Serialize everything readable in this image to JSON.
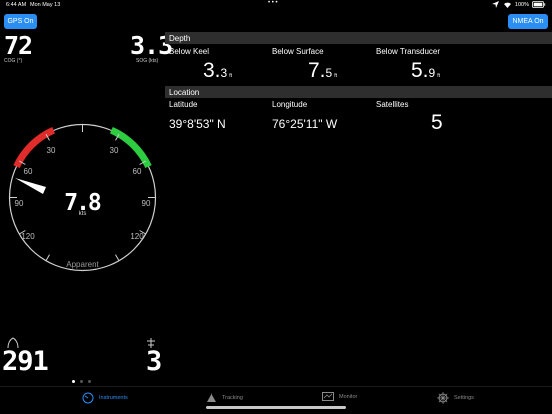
{
  "status_bar": {
    "time": "6:44 AM",
    "date": "Mon May 13",
    "dots": "• • •",
    "battery_text": "100%"
  },
  "left_panel": {
    "gps_button": "GPS On",
    "cog_value": "72",
    "cog_label": "COG (°)",
    "sog_value": "3.3",
    "sog_label": "SOG (kts)",
    "gauge": {
      "speed_value": "7.8",
      "speed_unit": "kts",
      "mode_label": "Apparent",
      "ticks": [
        "30",
        "60",
        "90",
        "120",
        "30",
        "60",
        "90",
        "120"
      ],
      "needle_angle_deg": -60,
      "port_color": "#e02b2b",
      "starboard_color": "#2ecc40"
    },
    "bottom_left_value": "291",
    "bottom_right_value": "3",
    "page_dots": 3,
    "active_page": 0
  },
  "right_panel": {
    "nmea_button": "NMEA On",
    "depth": {
      "header": "Depth",
      "columns": [
        {
          "label": "Below Keel",
          "whole": "3.",
          "frac": "3",
          "unit": "ft"
        },
        {
          "label": "Below Surface",
          "whole": "7.",
          "frac": "5",
          "unit": "ft"
        },
        {
          "label": "Below Transducer",
          "whole": "5.",
          "frac": "9",
          "unit": "ft"
        }
      ]
    },
    "location": {
      "header": "Location",
      "latitude_label": "Latitude",
      "latitude_value": "39°8'53\" N",
      "longitude_label": "Longitude",
      "longitude_value": "76°25'11\" W",
      "satellites_label": "Satellites",
      "satellites_value": "5"
    }
  },
  "tab_bar": {
    "tabs": [
      {
        "label": "Instruments",
        "icon": "gauge-icon",
        "active": true
      },
      {
        "label": "Tracking",
        "icon": "sail-icon",
        "active": false
      },
      {
        "label": "Monitor",
        "icon": "monitor-icon",
        "active": false
      },
      {
        "label": "Settings",
        "icon": "helm-icon",
        "active": false
      }
    ],
    "accent": "#2a8ef2"
  }
}
